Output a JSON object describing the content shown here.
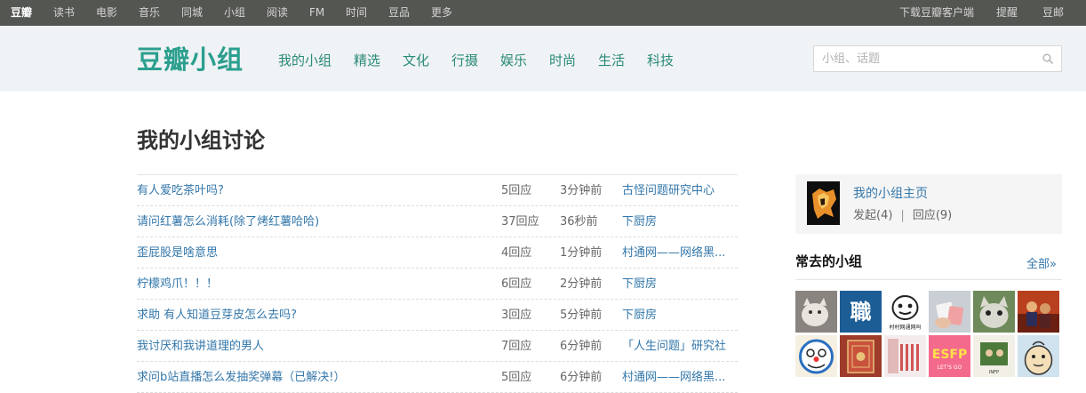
{
  "topnav": {
    "items": [
      "豆瓣",
      "读书",
      "电影",
      "音乐",
      "同城",
      "小组",
      "阅读",
      "FM",
      "时间",
      "豆品",
      "更多"
    ],
    "right": [
      "下载豆瓣客户端",
      "提醒",
      "豆邮"
    ]
  },
  "header": {
    "logo": "豆瓣小组",
    "nav": [
      "我的小组",
      "精选",
      "文化",
      "行摄",
      "娱乐",
      "时尚",
      "生活",
      "科技"
    ],
    "search_placeholder": "小组、话题"
  },
  "main": {
    "title": "我的小组讨论",
    "topics": [
      {
        "title": "有人爱吃茶叶吗?",
        "replies": "5回应",
        "time": "3分钟前",
        "group": "古怪问题研究中心"
      },
      {
        "title": "请问红薯怎么消耗(除了烤红薯哈哈)",
        "replies": "37回应",
        "time": "36秒前",
        "group": "下厨房"
      },
      {
        "title": "歪屁股是啥意思",
        "replies": "4回应",
        "time": "1分钟前",
        "group": "村通网——网络黑..."
      },
      {
        "title": "柠檬鸡爪！！！",
        "replies": "6回应",
        "time": "2分钟前",
        "group": "下厨房"
      },
      {
        "title": "求助 有人知道豆芽皮怎么去吗?",
        "replies": "3回应",
        "time": "5分钟前",
        "group": "下厨房"
      },
      {
        "title": "我讨厌和我讲道理的男人",
        "replies": "7回应",
        "time": "6分钟前",
        "group": "「人生问题」研究社"
      },
      {
        "title": "求问b站直播怎么发抽奖弹幕（已解决!）",
        "replies": "5回应",
        "time": "6分钟前",
        "group": "村通网——网络黑..."
      }
    ]
  },
  "sidebar": {
    "my_groups_link": "我的小组主页",
    "posted": "发起(4)",
    "separator": "|",
    "replied": "回应(9)",
    "frequent_title": "常去的小组",
    "all_link": "全部»",
    "thumb_texts": [
      "職",
      "村村网通网吗",
      "ESFP",
      "LET'S GO",
      "INFP"
    ]
  }
}
